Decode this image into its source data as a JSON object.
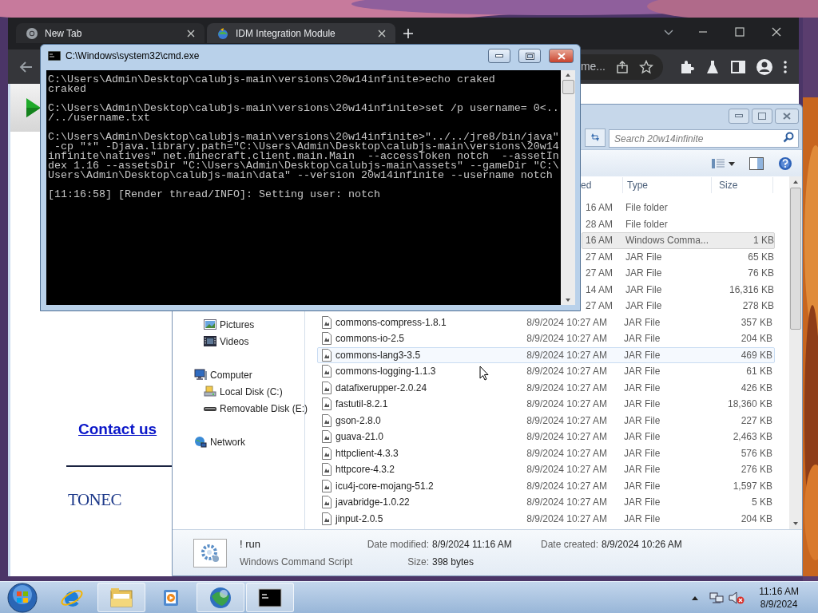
{
  "browser": {
    "tabs": [
      {
        "title": "New Tab",
        "kind": "newtab",
        "selected": false
      },
      {
        "title": "IDM Integration Module",
        "kind": "idm",
        "selected": true
      }
    ],
    "address": "me...",
    "page": {
      "contact_link": "Contact us",
      "logo": "TONEC"
    }
  },
  "explorer": {
    "search": {
      "placeholder": "Search 20w14infinite"
    },
    "columns": {
      "modified": "ed",
      "type": "Type",
      "size": "Size"
    },
    "navigation": [
      {
        "children": [
          {
            "label": "Pictures",
            "kind": "pictures"
          },
          {
            "label": "Videos",
            "kind": "videos"
          }
        ]
      },
      {
        "label": "Computer",
        "kind": "computer",
        "children": [
          {
            "label": "Local Disk (C:)",
            "kind": "disk"
          },
          {
            "label": "Removable Disk (E:)",
            "kind": "removable"
          }
        ]
      },
      {
        "label": "Network",
        "kind": "network"
      }
    ],
    "files": [
      {
        "modified": "16 AM",
        "type": "File folder",
        "selected": false,
        "hovered": false
      },
      {
        "modified": "28 AM",
        "type": "File folder",
        "selected": false,
        "hovered": false
      },
      {
        "modified": "16 AM",
        "type": "Windows Comma...",
        "size": "1 KB",
        "selected": true,
        "hovered": false
      },
      {
        "modified": "27 AM",
        "type": "JAR File",
        "size": "65 KB",
        "selected": false,
        "hovered": false
      },
      {
        "modified": "27 AM",
        "type": "JAR File",
        "size": "76 KB",
        "selected": false,
        "hovered": false
      },
      {
        "modified": "14 AM",
        "type": "JAR File",
        "size": "16,316 KB",
        "selected": false,
        "hovered": false
      },
      {
        "modified": "27 AM",
        "type": "JAR File",
        "size": "278 KB",
        "selected": false,
        "hovered": false
      },
      {
        "name": "commons-compress-1.8.1",
        "modified": "8/9/2024 10:27 AM",
        "type": "JAR File",
        "size": "357 KB",
        "selected": false,
        "hovered": false
      },
      {
        "name": "commons-io-2.5",
        "modified": "8/9/2024 10:27 AM",
        "type": "JAR File",
        "size": "204 KB",
        "selected": false,
        "hovered": false
      },
      {
        "name": "commons-lang3-3.5",
        "modified": "8/9/2024 10:27 AM",
        "type": "JAR File",
        "size": "469 KB",
        "selected": false,
        "hovered": true
      },
      {
        "name": "commons-logging-1.1.3",
        "modified": "8/9/2024 10:27 AM",
        "type": "JAR File",
        "size": "61 KB",
        "selected": false,
        "hovered": false
      },
      {
        "name": "datafixerupper-2.0.24",
        "modified": "8/9/2024 10:27 AM",
        "type": "JAR File",
        "size": "426 KB",
        "selected": false,
        "hovered": false
      },
      {
        "name": "fastutil-8.2.1",
        "modified": "8/9/2024 10:27 AM",
        "type": "JAR File",
        "size": "18,360 KB",
        "selected": false,
        "hovered": false
      },
      {
        "name": "gson-2.8.0",
        "modified": "8/9/2024 10:27 AM",
        "type": "JAR File",
        "size": "227 KB",
        "selected": false,
        "hovered": false
      },
      {
        "name": "guava-21.0",
        "modified": "8/9/2024 10:27 AM",
        "type": "JAR File",
        "size": "2,463 KB",
        "selected": false,
        "hovered": false
      },
      {
        "name": "httpclient-4.3.3",
        "modified": "8/9/2024 10:27 AM",
        "type": "JAR File",
        "size": "576 KB",
        "selected": false,
        "hovered": false
      },
      {
        "name": "httpcore-4.3.2",
        "modified": "8/9/2024 10:27 AM",
        "type": "JAR File",
        "size": "276 KB",
        "selected": false,
        "hovered": false
      },
      {
        "name": "icu4j-core-mojang-51.2",
        "modified": "8/9/2024 10:27 AM",
        "type": "JAR File",
        "size": "1,597 KB",
        "selected": false,
        "hovered": false
      },
      {
        "name": "javabridge-1.0.22",
        "modified": "8/9/2024 10:27 AM",
        "type": "JAR File",
        "size": "5 KB",
        "selected": false,
        "hovered": false
      },
      {
        "name": "jinput-2.0.5",
        "modified": "8/9/2024 10:27 AM",
        "type": "JAR File",
        "size": "204 KB",
        "selected": false,
        "hovered": false
      }
    ],
    "details": {
      "name": "! run",
      "type": "Windows Command Script",
      "modified_label": "Date modified:",
      "modified": "8/9/2024 11:16 AM",
      "size_label": "Size:",
      "size": "398 bytes",
      "created_label": "Date created:",
      "created": "8/9/2024 10:26 AM"
    }
  },
  "console": {
    "title": "C:\\Windows\\system32\\cmd.exe",
    "blocks": [
      [
        "C:\\Users\\Admin\\Desktop\\calubjs-main\\versions\\20w14infinite>echo craked",
        "craked"
      ],
      [
        "C:\\Users\\Admin\\Desktop\\calubjs-main\\versions\\20w14infinite>set /p username= 0<..",
        "/../username.txt"
      ],
      [
        "C:\\Users\\Admin\\Desktop\\calubjs-main\\versions\\20w14infinite>\"../../jre8/bin/java\"",
        " -cp \"*\" -Djava.library.path=\"C:\\Users\\Admin\\Desktop\\calubjs-main\\versions\\20w14",
        "infinite\\natives\" net.minecraft.client.main.Main  --accessToken notch  --assetIn",
        "dex 1.16 --assetsDir \"C:\\Users\\Admin\\Desktop\\calubjs-main\\assets\" --gameDir \"C:\\",
        "Users\\Admin\\Desktop\\calubjs-main\\data\" --version 20w14infinite --username notch"
      ],
      [
        "[11:16:58] [Render thread/INFO]: Setting user: notch"
      ]
    ]
  },
  "taskbar": {
    "apps": [
      {
        "kind": "ie",
        "running": false
      },
      {
        "kind": "folder",
        "running": true
      },
      {
        "kind": "media",
        "running": false
      },
      {
        "kind": "globe",
        "running": true
      },
      {
        "kind": "console",
        "running": true
      }
    ],
    "clock": {
      "time": "11:16 AM",
      "date": "8/9/2024"
    }
  }
}
